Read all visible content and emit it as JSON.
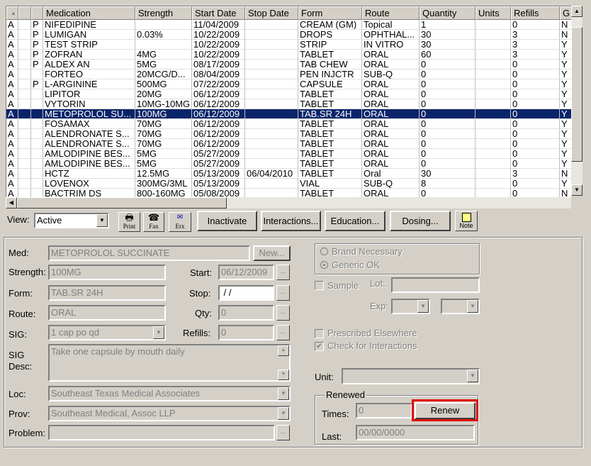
{
  "grid": {
    "columns": [
      "",
      "",
      "",
      "Medication",
      "Strength",
      "Start Date",
      "Stop Date",
      "Form",
      "Route",
      "Quantity",
      "Units",
      "Refills",
      "G"
    ],
    "selected_index": 9,
    "rows": [
      [
        "A",
        "",
        "P",
        "NIFEDIPINE",
        "",
        "11/04/2009",
        "",
        "CREAM (GM)",
        "Topical",
        "1",
        "",
        "0",
        "N"
      ],
      [
        "A",
        "",
        "P",
        "LUMIGAN",
        "0.03%",
        "10/22/2009",
        "",
        "DROPS",
        "OPHTHAL...",
        "30",
        "",
        "3",
        "N"
      ],
      [
        "A",
        "",
        "P",
        "TEST STRIP",
        "",
        "10/22/2009",
        "",
        "STRIP",
        "IN VITRO",
        "30",
        "",
        "3",
        "Y"
      ],
      [
        "A",
        "",
        "P",
        "ZOFRAN",
        "4MG",
        "10/22/2009",
        "",
        "TABLET",
        "ORAL",
        "60",
        "",
        "3",
        "Y"
      ],
      [
        "A",
        "",
        "P",
        "ALDEX AN",
        "5MG",
        "08/17/2009",
        "",
        "TAB CHEW",
        "ORAL",
        "0",
        "",
        "0",
        "Y"
      ],
      [
        "A",
        "",
        "",
        "FORTEO",
        "20MCG/D...",
        "08/04/2009",
        "",
        "PEN INJCTR",
        "SUB-Q",
        "0",
        "",
        "0",
        "Y"
      ],
      [
        "A",
        "",
        "P",
        "L-ARGININE",
        "500MG",
        "07/22/2009",
        "",
        "CAPSULE",
        "ORAL",
        "0",
        "",
        "0",
        "Y"
      ],
      [
        "A",
        "",
        "",
        "LIPITOR",
        "20MG",
        "06/12/2009",
        "",
        "TABLET",
        "ORAL",
        "0",
        "",
        "0",
        "Y"
      ],
      [
        "A",
        "",
        "",
        "VYTORIN",
        "10MG-10MG",
        "06/12/2009",
        "",
        "TABLET",
        "ORAL",
        "0",
        "",
        "0",
        "Y"
      ],
      [
        "A",
        "",
        "",
        "METOPROLOL SU...",
        "100MG",
        "06/12/2009",
        "",
        "TAB.SR 24H",
        "ORAL",
        "0",
        "",
        "0",
        "Y"
      ],
      [
        "A",
        "",
        "",
        "FOSAMAX",
        "70MG",
        "06/12/2009",
        "",
        "TABLET",
        "ORAL",
        "0",
        "",
        "0",
        "Y"
      ],
      [
        "A",
        "",
        "",
        "ALENDRONATE S...",
        "70MG",
        "06/12/2009",
        "",
        "TABLET",
        "ORAL",
        "0",
        "",
        "0",
        "Y"
      ],
      [
        "A",
        "",
        "",
        "ALENDRONATE S...",
        "70MG",
        "06/12/2009",
        "",
        "TABLET",
        "ORAL",
        "0",
        "",
        "0",
        "Y"
      ],
      [
        "A",
        "",
        "",
        "AMLODIPINE BES...",
        "5MG",
        "05/27/2009",
        "",
        "TABLET",
        "ORAL",
        "0",
        "",
        "0",
        "Y"
      ],
      [
        "A",
        "",
        "",
        "AMLODIPINE BES...",
        "5MG",
        "05/27/2009",
        "",
        "TABLET",
        "ORAL",
        "0",
        "",
        "0",
        "Y"
      ],
      [
        "A",
        "",
        "",
        "HCTZ",
        "12.5MG",
        "05/13/2009",
        "06/04/2010",
        "TABLET",
        "Oral",
        "30",
        "",
        "3",
        "N"
      ],
      [
        "A",
        "",
        "",
        "LOVENOX",
        "300MG/3ML",
        "05/13/2009",
        "",
        "VIAL",
        "SUB-Q",
        "8",
        "",
        "0",
        "Y"
      ],
      [
        "A",
        "",
        "",
        "BACTRIM DS",
        "800-160MG",
        "05/08/2009",
        "",
        "TABLET",
        "ORAL",
        "0",
        "",
        "0",
        "N"
      ]
    ]
  },
  "toolbar": {
    "view_label": "View:",
    "view_value": "Active",
    "print": "Print",
    "fax": "Fax",
    "erx": "Erx",
    "inactivate": "Inactivate",
    "interactions": "Interactions...",
    "education": "Education...",
    "dosing": "Dosing...",
    "note": "Note"
  },
  "form": {
    "med_label": "Med:",
    "med": "METOPROLOL SUCCINATE",
    "new": "New...",
    "strength_label": "Strength:",
    "strength": "100MG",
    "form_label": "Form:",
    "form": "TAB.SR 24H",
    "route_label": "Route:",
    "route": "ORAL",
    "sig_label": "SIG:",
    "sig": "1 cap po qd",
    "sigdesc_label1": "SIG",
    "sigdesc_label2": "Desc:",
    "sigdesc": "Take one capsule by mouth daily",
    "loc_label": "Loc:",
    "loc": "Southeast Texas Medical Associates",
    "prov_label": "Prov:",
    "prov": "Southeast Medical, Assoc LLP",
    "problem_label": "Problem:",
    "problem": "",
    "start_label": "Start:",
    "start": "06/12/2009",
    "stop_label": "Stop:",
    "stop": " / /",
    "qty_label": "Qty:",
    "qty": "0",
    "refills_label": "Refills:",
    "refills": "0",
    "dots": "...",
    "brand": "Brand Necessary",
    "generic": "Generic OK",
    "generic_selected": true,
    "sample": "Sample",
    "lot_label": "Lot:",
    "exp_label": "Exp:",
    "prescribed": "Prescribed Elsewhere",
    "prescribed_checked": false,
    "check_interactions": "Check for Interactions",
    "check_interactions_checked": true,
    "unit_label": "Unit:",
    "renewed_title": "Renewed",
    "times_label": "Times:",
    "times": "0",
    "renew": "Renew",
    "last_label": "Last:",
    "last": "00/00/0000"
  },
  "colors": {
    "selection": "#0a246a",
    "highlight": "#e00000",
    "face": "#d4d0c8"
  }
}
